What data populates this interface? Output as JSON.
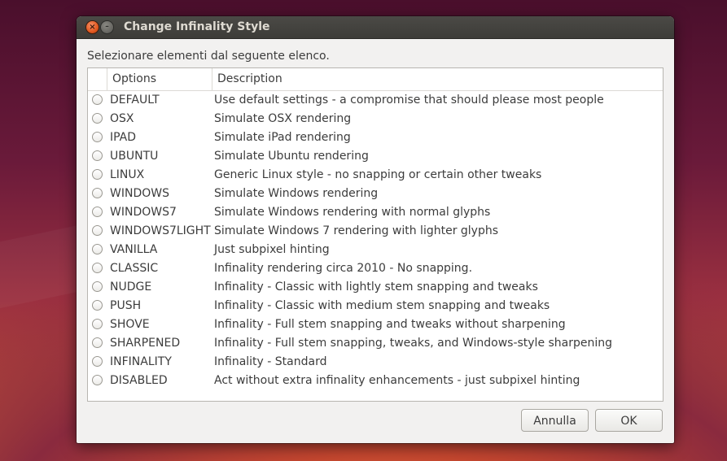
{
  "window": {
    "title": "Change Infinality Style",
    "close_glyph": "×",
    "minimize_glyph": "–"
  },
  "prompt": "Selezionare elementi dal seguente elenco.",
  "table": {
    "columns": [
      "",
      "Options",
      "Description"
    ],
    "rows": [
      {
        "option": "DEFAULT",
        "description": "Use default settings - a compromise that should please most people",
        "selected": false
      },
      {
        "option": "OSX",
        "description": "Simulate OSX rendering",
        "selected": false
      },
      {
        "option": "IPAD",
        "description": "Simulate iPad rendering",
        "selected": false
      },
      {
        "option": "UBUNTU",
        "description": "Simulate Ubuntu rendering",
        "selected": false
      },
      {
        "option": "LINUX",
        "description": "Generic Linux style - no snapping or certain other tweaks",
        "selected": false
      },
      {
        "option": "WINDOWS",
        "description": "Simulate Windows rendering",
        "selected": false
      },
      {
        "option": "WINDOWS7",
        "description": "Simulate Windows rendering with normal glyphs",
        "selected": false
      },
      {
        "option": "WINDOWS7LIGHT",
        "description": "Simulate Windows 7 rendering with lighter glyphs",
        "selected": false
      },
      {
        "option": "VANILLA",
        "description": "Just subpixel hinting",
        "selected": false
      },
      {
        "option": "CLASSIC",
        "description": "Infinality rendering circa 2010 - No snapping.",
        "selected": false
      },
      {
        "option": "NUDGE",
        "description": "Infinality - Classic with lightly stem snapping and tweaks",
        "selected": false
      },
      {
        "option": "PUSH",
        "description": "Infinality - Classic with medium stem snapping and tweaks",
        "selected": false
      },
      {
        "option": "SHOVE",
        "description": "Infinality - Full stem snapping and tweaks without sharpening",
        "selected": false
      },
      {
        "option": "SHARPENED",
        "description": "Infinality - Full stem snapping, tweaks, and Windows-style sharpening",
        "selected": false
      },
      {
        "option": "INFINALITY",
        "description": "Infinality - Standard",
        "selected": false
      },
      {
        "option": "DISABLED",
        "description": "Act without extra infinality enhancements - just subpixel hinting",
        "selected": false
      }
    ]
  },
  "buttons": {
    "cancel_label": "Annulla",
    "ok_label": "OK"
  },
  "icons": {
    "close": "close-icon",
    "minimize": "minimize-icon",
    "radio": "radio-button"
  },
  "colors": {
    "titlebar": "#3d3c38",
    "close_button": "#e2571e",
    "dialog_background": "#f2f1f0",
    "text": "#3c3c3c"
  }
}
